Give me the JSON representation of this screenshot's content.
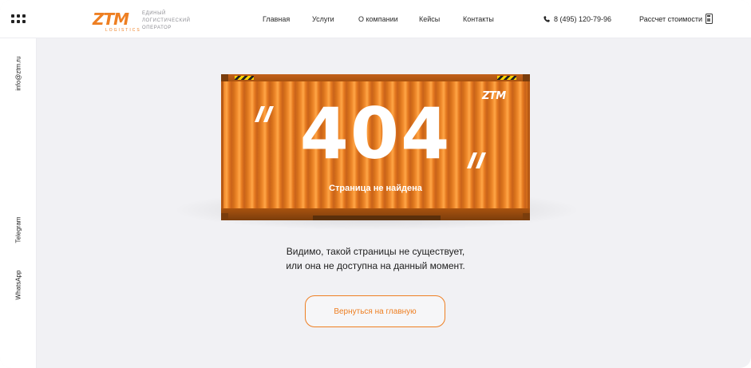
{
  "header": {
    "logo_text": "ZTM",
    "logo_sub": "LOGISTICS",
    "tagline": "Единый логистический оператор",
    "nav": [
      {
        "label": "Главная"
      },
      {
        "label": "Услуги"
      },
      {
        "label": "О компании"
      },
      {
        "label": "Кейсы"
      },
      {
        "label": "Контакты"
      }
    ],
    "phone": "8 (495) 120-79-96",
    "calc_label": "Рассчет стоимости",
    "menu_icon": "grid-menu-icon",
    "phone_icon": "phone-icon",
    "calc_icon": "calculator-icon"
  },
  "sidebar": {
    "email": "info@ztm.ru",
    "telegram": "Telegram",
    "whatsapp": "WhatsApp"
  },
  "error": {
    "code": "404",
    "title": "Страница не найдена",
    "container_logo": "ZTM",
    "message_line1": "Видимо, такой страницы не существует,",
    "message_line2": "или она не доступна на данный момент.",
    "button_label": "Вернуться на главную"
  },
  "colors": {
    "accent": "#ee7f22",
    "container": "#f08a2c",
    "background": "#f1f1f4"
  }
}
